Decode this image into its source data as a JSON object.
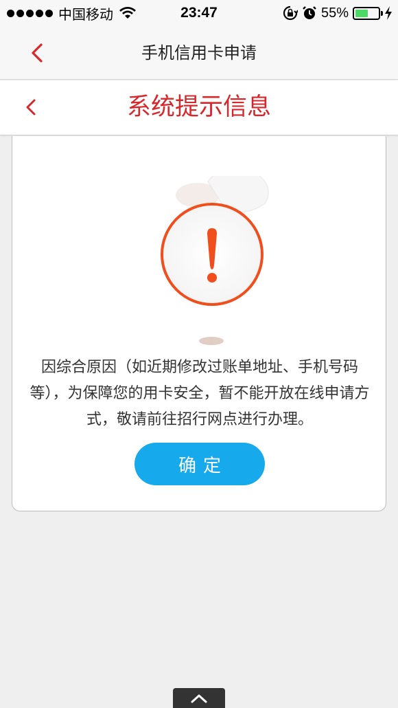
{
  "status_bar": {
    "carrier": "中国移动",
    "time": "23:47",
    "battery_percent": "55%",
    "battery_level": 0.55
  },
  "nav": {
    "title": "手机信用卡申请"
  },
  "sub_header": {
    "title": "系统提示信息"
  },
  "dialog": {
    "message": "因综合原因（如近期修改过账单地址、手机号码等），为保障您的用卡安全，暂不能开放在线申请方式，敬请前往招行网点进行办理。",
    "confirm_label": "确定"
  },
  "colors": {
    "accent_red": "#d8272b",
    "alert_orange": "#f04e1c",
    "button_blue": "#16a9ec",
    "battery_green": "#4cd964"
  },
  "icons": {
    "back": "chevron-left-icon",
    "alert": "exclamation-circle-icon",
    "scroll_top": "chevron-up-icon"
  }
}
